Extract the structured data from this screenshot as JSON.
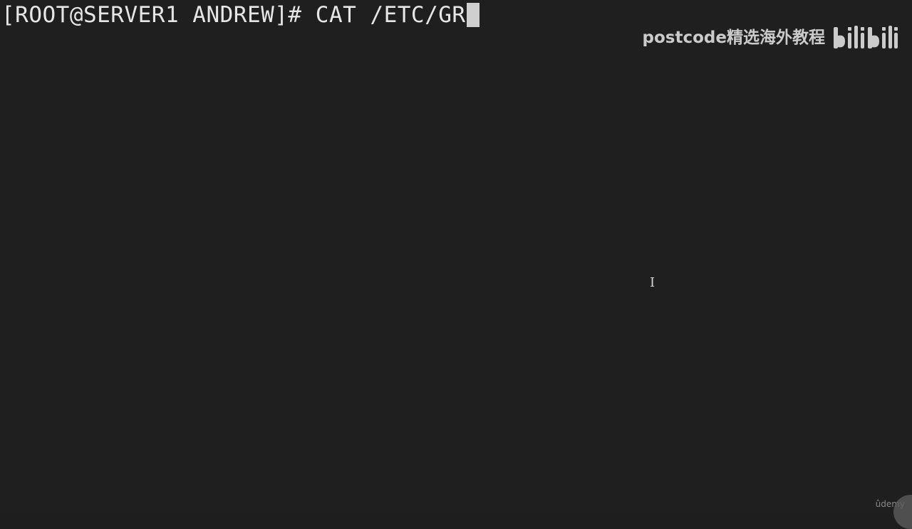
{
  "terminal": {
    "prompt": "[ROOT@SERVER1 ANDREW]#",
    "command": "CAT /ETC/GR",
    "cursor_shape": "block"
  },
  "watermark": {
    "text": "postcode精选海外教程",
    "logo_icon": "bilibili-logo-icon"
  },
  "footer": {
    "brand": "ûdemy"
  },
  "colors": {
    "background": "#1f1f1f",
    "text": "#e6e6e6",
    "cursor": "#cfcfcf"
  }
}
